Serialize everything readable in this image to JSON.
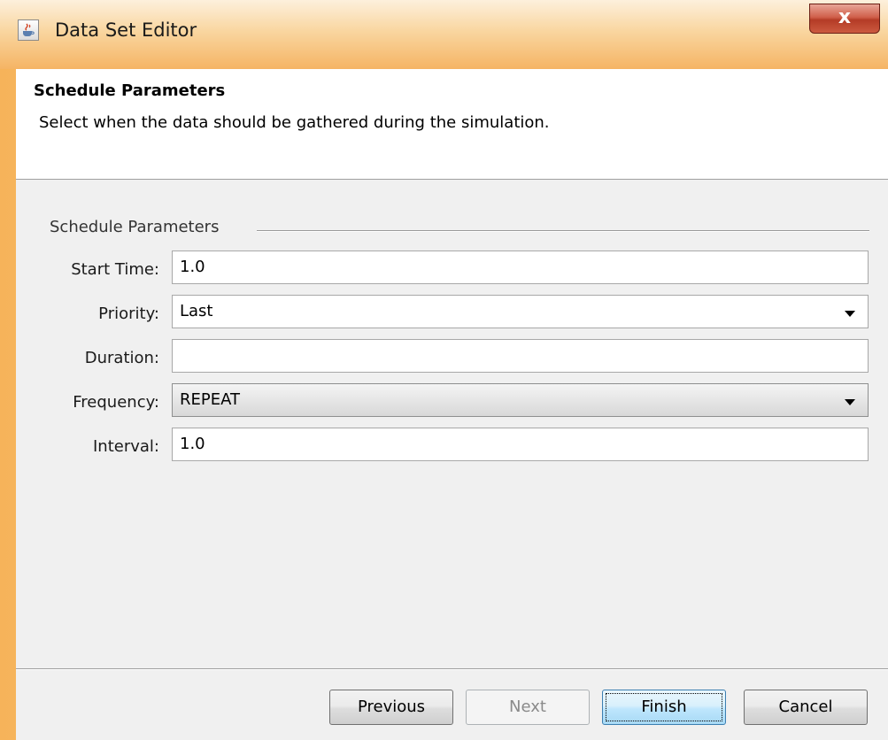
{
  "window": {
    "title": "Data Set Editor",
    "close_label": "x",
    "icon": "java-cup-icon",
    "accent_color": "#f5b464"
  },
  "header": {
    "title": "Schedule Parameters",
    "description": "Select when the data should be gathered during the simulation."
  },
  "group": {
    "title": "Schedule Parameters"
  },
  "form": {
    "start_time": {
      "label": "Start Time:",
      "value": "1.0"
    },
    "priority": {
      "label": "Priority:",
      "value": "Last"
    },
    "duration": {
      "label": "Duration:",
      "value": ""
    },
    "frequency": {
      "label": "Frequency:",
      "value": "REPEAT"
    },
    "interval": {
      "label": "Interval:",
      "value": "1.0"
    }
  },
  "buttons": {
    "previous": "Previous",
    "next": "Next",
    "finish": "Finish",
    "cancel": "Cancel"
  }
}
